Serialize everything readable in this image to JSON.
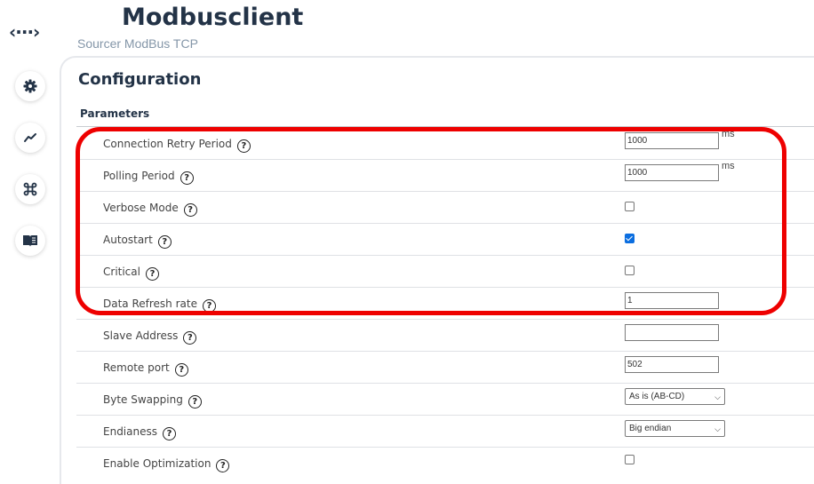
{
  "app": {
    "icon": "code-brackets-icon",
    "icon_glyph": "‹···›",
    "title": "Modbusclient",
    "subtitle": "Sourcer ModBus TCP"
  },
  "sidebar": {
    "items": [
      {
        "name": "settings",
        "icon": "gear-icon"
      },
      {
        "name": "metrics",
        "icon": "chart-line-icon"
      },
      {
        "name": "commands",
        "icon": "command-key-icon"
      },
      {
        "name": "docs",
        "icon": "book-icon"
      }
    ]
  },
  "section": {
    "title": "Configuration",
    "subtitle": "Parameters"
  },
  "help_glyph": "?",
  "parameters": {
    "connection_retry_period": {
      "label": "Connection Retry Period",
      "value": "1000",
      "unit": "ms"
    },
    "polling_period": {
      "label": "Polling Period",
      "value": "1000",
      "unit": "ms"
    },
    "verbose_mode": {
      "label": "Verbose Mode",
      "checked": false
    },
    "autostart": {
      "label": "Autostart",
      "checked": true
    },
    "critical": {
      "label": "Critical",
      "checked": false
    },
    "data_refresh_rate": {
      "label": "Data Refresh rate",
      "value": "1"
    },
    "slave_address": {
      "label": "Slave Address",
      "value": ""
    },
    "remote_port": {
      "label": "Remote port",
      "value": "502"
    },
    "byte_swapping": {
      "label": "Byte Swapping",
      "selected": "As is (AB-CD)"
    },
    "endianess": {
      "label": "Endianess",
      "selected": "Big endian"
    },
    "enable_optimization": {
      "label": "Enable Optimization",
      "checked": false
    }
  },
  "annotation": {
    "color": "#ee0000"
  }
}
